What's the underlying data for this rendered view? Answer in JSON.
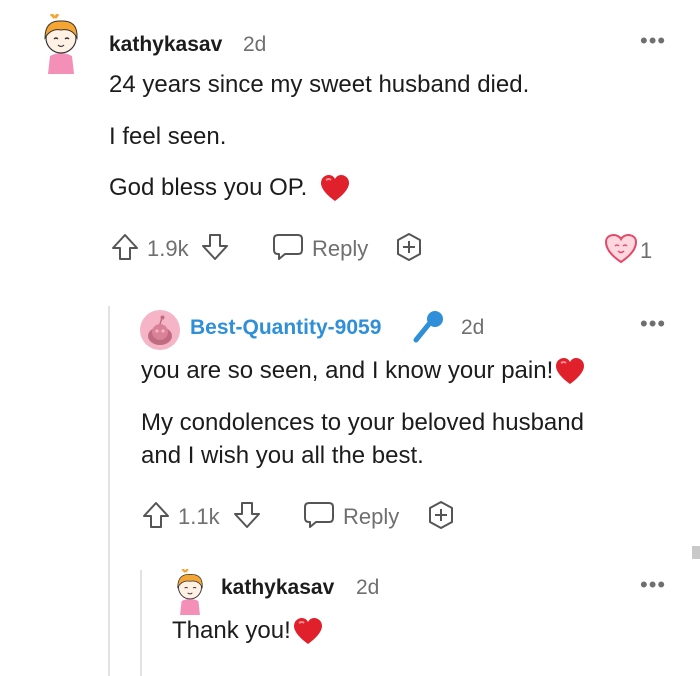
{
  "comment1": {
    "username": "kathykasav",
    "time": "2d",
    "lines": [
      "24 years since my sweet husband died.",
      "I feel seen.",
      "God bless you OP."
    ],
    "score": "1.9k",
    "reply_label": "Reply",
    "award_count": "1"
  },
  "comment2": {
    "username": "Best-Quantity-9059",
    "time": "2d",
    "line1": "you are so seen, and I know your pain!",
    "line2a": "My condolences to your beloved husband",
    "line2b": "and I wish you all the best.",
    "score": "1.1k",
    "reply_label": "Reply"
  },
  "comment3": {
    "username": "kathykasav",
    "time": "2d",
    "line1": "Thank you!"
  },
  "icons": [
    "avatar-kathykasav",
    "avatar-snoo",
    "microphone-icon",
    "upvote-icon",
    "downvote-icon",
    "reply-icon",
    "award-icon",
    "heart-emoji",
    "more-options-icon"
  ],
  "colors": {
    "accent_blue": "#2f8fd8",
    "heart_red": "#e0202a",
    "avatar_pink": "#f6b5c6"
  }
}
